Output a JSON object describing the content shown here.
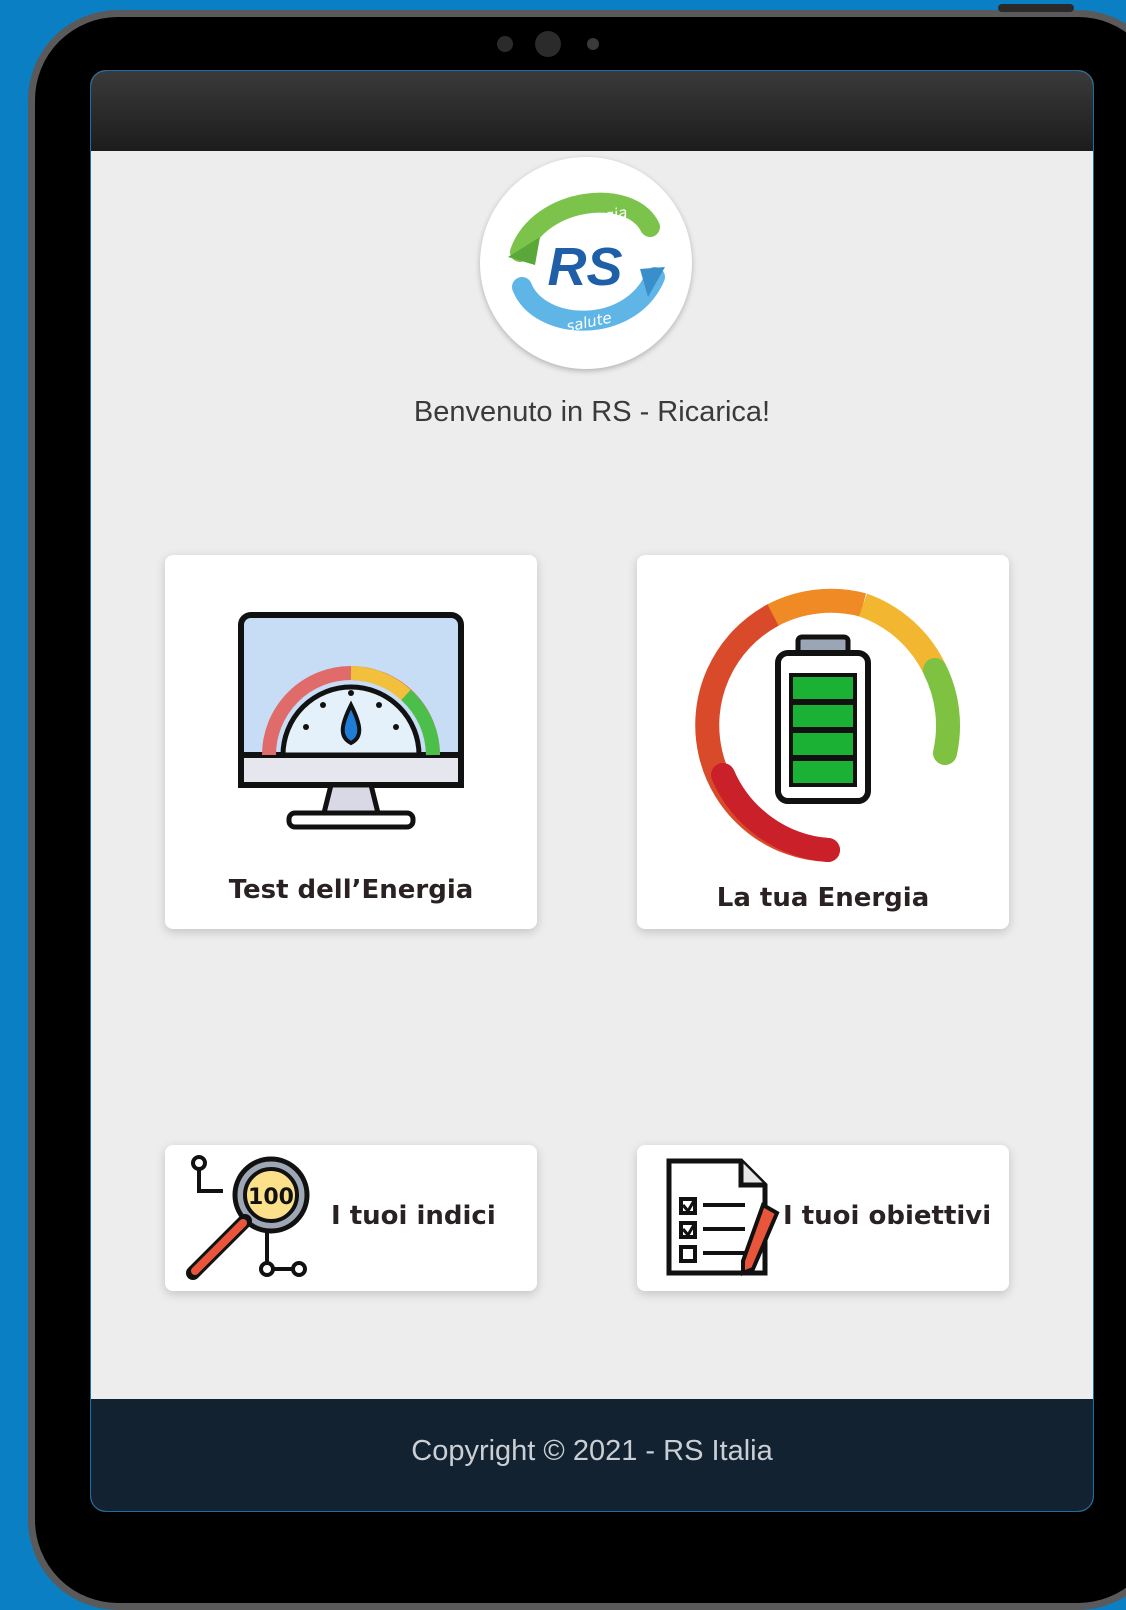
{
  "app": {
    "logo_text_top": "energia",
    "logo_text_center": "RS",
    "logo_text_bottom": "salute",
    "welcome": "Benvenuto in RS - Ricarica!"
  },
  "cards": [
    {
      "label": "Test dell’Energia",
      "icon": "monitor-speedometer-icon"
    },
    {
      "label": "La tua Energia",
      "icon": "battery-gauge-icon"
    },
    {
      "label": "I tuoi indici",
      "icon": "magnifier-100-icon",
      "badge": "100"
    },
    {
      "label": "I tuoi obiettivi",
      "icon": "checklist-pencil-icon"
    }
  ],
  "footer": {
    "copyright": "Copyright © 2021 - RS Italia"
  },
  "colors": {
    "background": "#0a7fc4",
    "screen": "#ededed",
    "footer": "#132230",
    "gauge_red": "#d92b2b",
    "gauge_orange": "#f08a24",
    "gauge_yellow": "#f2b630",
    "gauge_green": "#7fc241"
  }
}
